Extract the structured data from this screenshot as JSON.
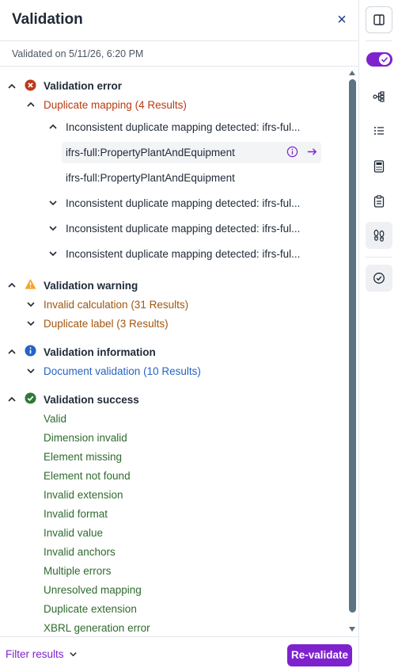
{
  "header": {
    "title": "Validation",
    "close_icon": "×"
  },
  "subheader": {
    "validated_on": "Validated on 5/11/26, 6:20 PM"
  },
  "sections": {
    "error": {
      "title": "Validation error",
      "status_color": "#c0391b",
      "group": {
        "label": "Duplicate mapping (4 Results)",
        "items": [
          {
            "label": "Inconsistent duplicate mapping detected: ifrs-ful...",
            "expanded": true,
            "children": [
              "ifrs-full:PropertyPlantAndEquipment",
              "ifrs-full:PropertyPlantAndEquipment"
            ]
          },
          {
            "label": "Inconsistent duplicate mapping detected: ifrs-ful...",
            "expanded": false
          },
          {
            "label": "Inconsistent duplicate mapping detected: ifrs-ful...",
            "expanded": false
          },
          {
            "label": "Inconsistent duplicate mapping detected: ifrs-ful...",
            "expanded": false
          }
        ]
      }
    },
    "warning": {
      "title": "Validation warning",
      "status_color": "#f5a623",
      "groups": [
        "Invalid calculation (31 Results)",
        "Duplicate label (3 Results)"
      ]
    },
    "information": {
      "title": "Validation information",
      "status_color": "#2563c4",
      "groups": [
        "Document validation (10 Results)"
      ]
    },
    "success": {
      "title": "Validation success",
      "status_color": "#2f7a3a",
      "items": [
        "Valid",
        "Dimension invalid",
        "Element missing",
        "Element not found",
        "Invalid extension",
        "Invalid format",
        "Invalid value",
        "Invalid anchors",
        "Multiple errors",
        "Unresolved mapping",
        "Duplicate extension",
        "XBRL generation error"
      ]
    }
  },
  "footer": {
    "filter_label": "Filter results",
    "revalidate_label": "Re-validate"
  },
  "rail": {
    "icons": [
      "panel-layout-icon",
      "toggle-switch",
      "hierarchy-icon",
      "list-icon",
      "calculator-icon",
      "clipboard-icon",
      "footsteps-icon",
      "check-circle-icon"
    ],
    "toggle_on": true
  },
  "colors": {
    "accent": "#7e22ce",
    "error_text": "#b93b14",
    "warning_text": "#a0560c",
    "info_text": "#2563c4",
    "success_text": "#2f6b2f"
  }
}
